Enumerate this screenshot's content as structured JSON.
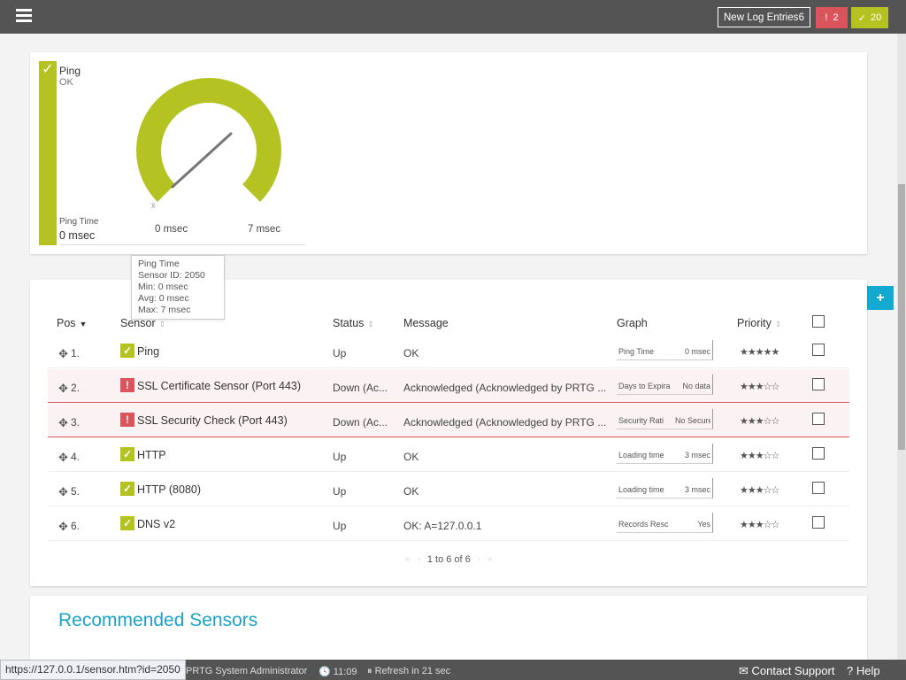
{
  "topbar": {
    "log_label": "New Log Entries",
    "log_count": "6",
    "down_icon": "!",
    "down_count": "2",
    "up_icon": "✓",
    "up_count": "20"
  },
  "gauge": {
    "title": "Ping",
    "status": "OK",
    "channel_label": "Ping Time",
    "channel_value": "0 msec",
    "min_label": "0 msec",
    "max_label": "7 msec",
    "needle_fraction": 0.0,
    "color": "#b4c322"
  },
  "tooltip": {
    "line1": "Ping Time",
    "line2": "Sensor ID: 2050",
    "line3": "Min: 0 msec",
    "line4": "Avg: 0 msec",
    "line5": "Max: 7 msec"
  },
  "table": {
    "headers": [
      "Pos",
      "Sensor",
      "Status",
      "Message",
      "Graph",
      "Priority"
    ],
    "rows": [
      {
        "pos": "1.",
        "icon": "✓",
        "state": "up",
        "sensor": "Ping",
        "status": "Up",
        "message": "OK",
        "graph_label": "Ping Time",
        "graph_value": "0 msec",
        "priority": "★★★★★"
      },
      {
        "pos": "2.",
        "icon": "!",
        "state": "down",
        "sensor": "SSL Certificate Sensor (Port 443)",
        "status": "Down (Ac...",
        "message": "Acknowledged (Acknowledged by PRTG ...",
        "graph_label": "Days to Expira",
        "graph_value": "No data",
        "priority": "★★★☆☆"
      },
      {
        "pos": "3.",
        "icon": "!",
        "state": "down",
        "sensor": "SSL Security Check (Port 443)",
        "status": "Down (Ac...",
        "message": "Acknowledged (Acknowledged by PRTG ...",
        "graph_label": "Security Rati",
        "graph_value": "No Secure Pr",
        "priority": "★★★☆☆"
      },
      {
        "pos": "4.",
        "icon": "✓",
        "state": "up",
        "sensor": "HTTP",
        "status": "Up",
        "message": "OK",
        "graph_label": "Loading time",
        "graph_value": "3 msec",
        "priority": "★★★☆☆"
      },
      {
        "pos": "5.",
        "icon": "✓",
        "state": "up",
        "sensor": "HTTP (8080)",
        "status": "Up",
        "message": "OK",
        "graph_label": "Loading time",
        "graph_value": "3 msec",
        "priority": "★★★☆☆"
      },
      {
        "pos": "6.",
        "icon": "✓",
        "state": "up",
        "sensor": "DNS v2",
        "status": "Up",
        "message": "OK: A=127.0.0.1",
        "graph_label": "Records Resc",
        "graph_value": "Yes",
        "priority": "★★★☆☆"
      }
    ],
    "pager": "1 to 6 of 6"
  },
  "recommended": {
    "title": "Recommended Sensors"
  },
  "footer": {
    "url": "https://127.0.0.1/sensor.htm?id=2050",
    "admin": "PRTG System Administrator",
    "time": "11:09",
    "refresh": "Refresh in 21 sec",
    "support": "Contact Support",
    "help": "Help"
  },
  "colors": {
    "up": "#b4c322",
    "down": "#d9545b",
    "accent": "#14a9d1"
  }
}
